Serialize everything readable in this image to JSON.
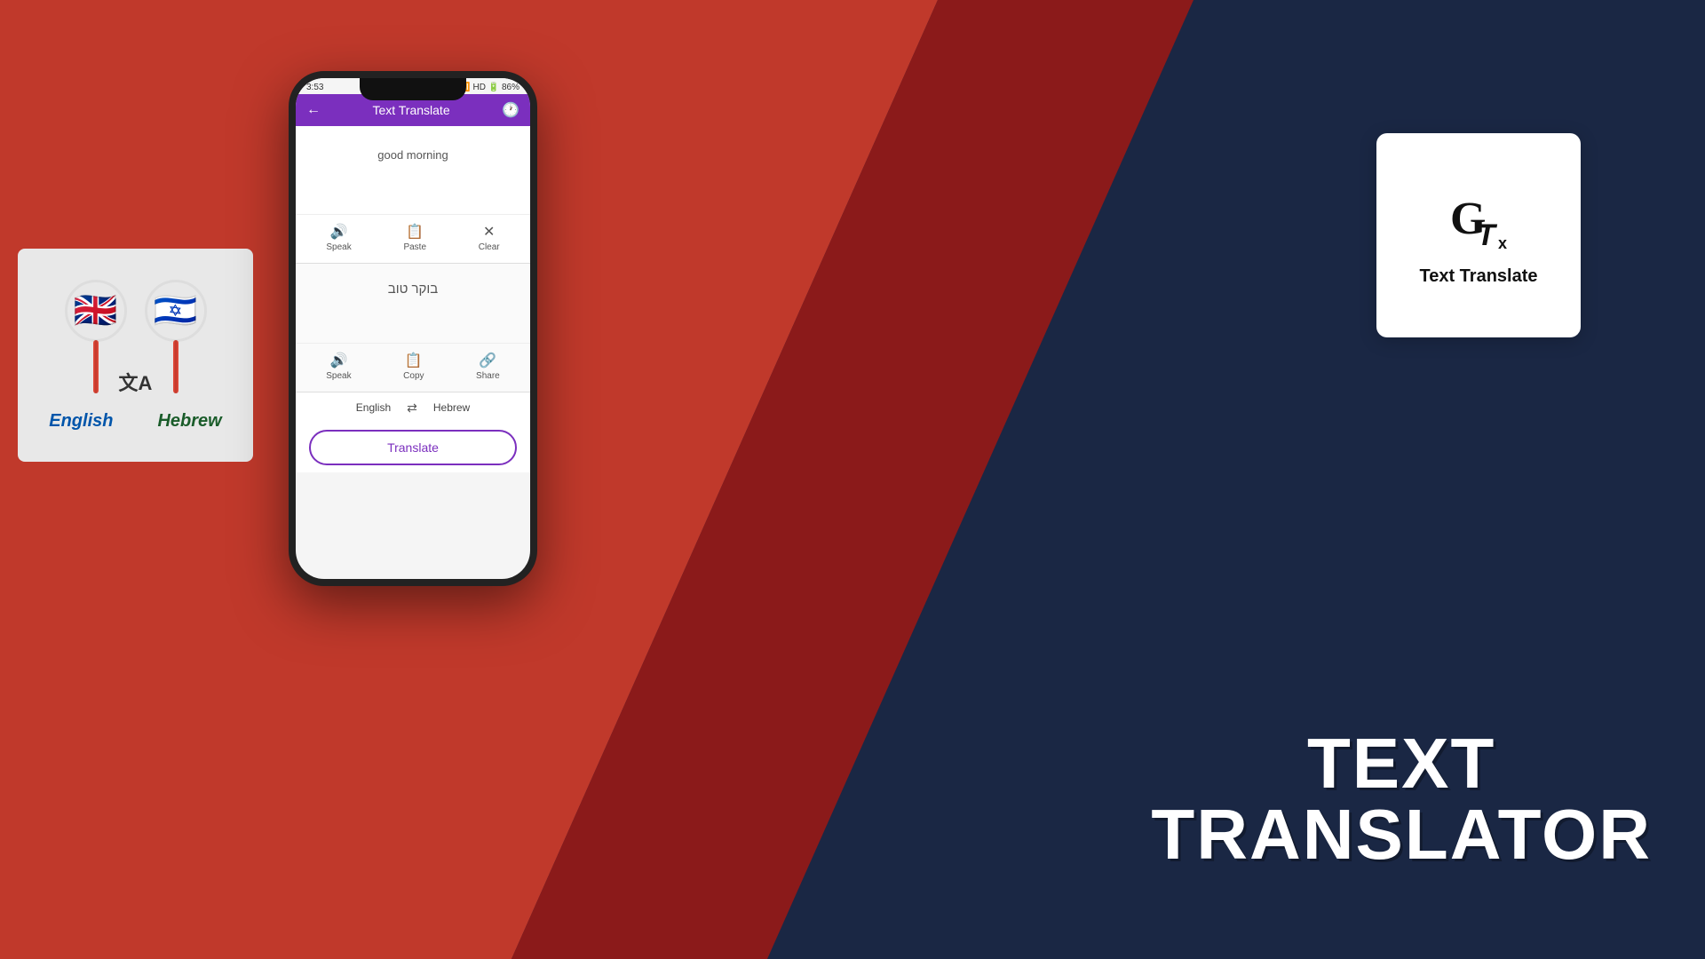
{
  "background": {
    "color_red": "#c0392b",
    "color_dark": "#1a2744"
  },
  "left_card": {
    "flag_english": "🇬🇧",
    "flag_hebrew": "🇮🇱",
    "label_english": "English",
    "label_hebrew": "Hebrew",
    "translate_icon": "文A"
  },
  "phone": {
    "status_bar": {
      "time": "3:53",
      "signal": "HD",
      "battery": "86%"
    },
    "header": {
      "title": "Text Translate",
      "back_icon": "←",
      "history_icon": "🕐"
    },
    "input_section": {
      "placeholder": "good morning",
      "speak_label": "Speak",
      "paste_label": "Paste",
      "clear_label": "Clear"
    },
    "output_section": {
      "translated_text": "בוקר טוב",
      "speak_label": "Speak",
      "copy_label": "Copy",
      "share_label": "Share"
    },
    "language_bar": {
      "source_lang": "English",
      "target_lang": "Hebrew",
      "swap_icon": "⇄"
    },
    "translate_button": {
      "label": "Translate"
    }
  },
  "right_card": {
    "logo_text": "GT",
    "title": "Text Translate"
  },
  "big_text": {
    "line1": "TEXT",
    "line2": "TRANSLATOR"
  }
}
